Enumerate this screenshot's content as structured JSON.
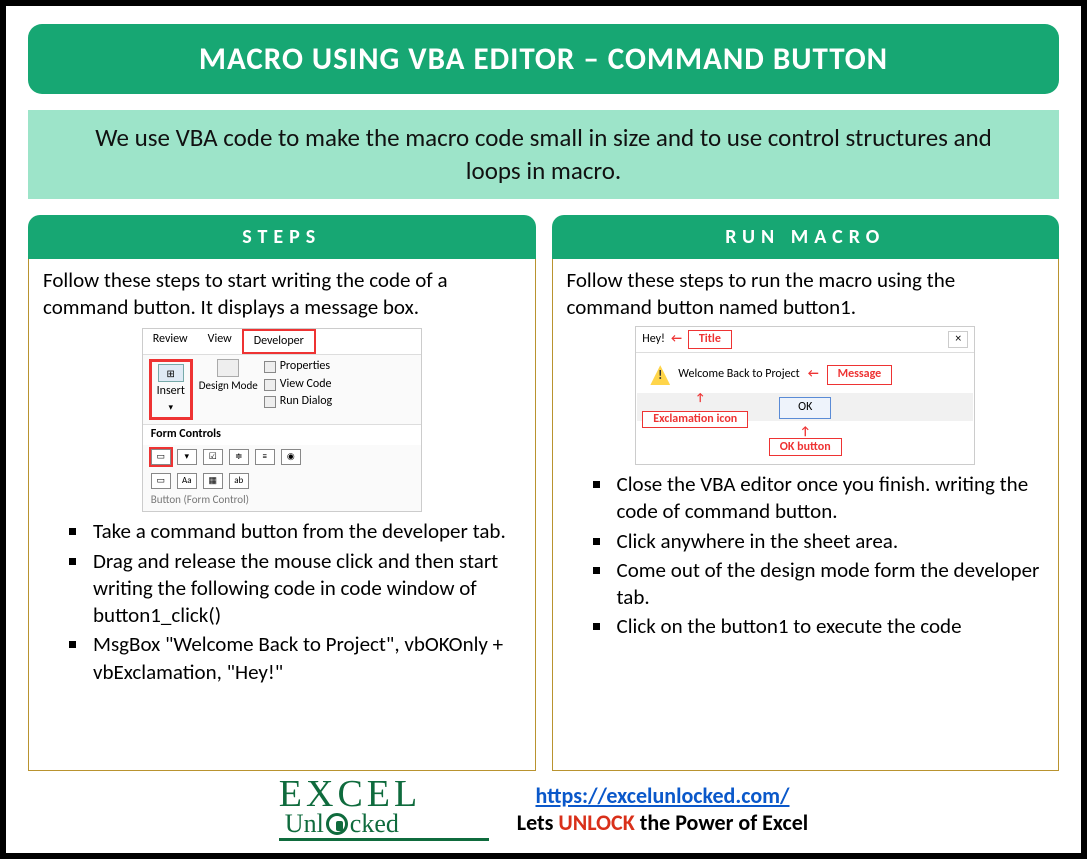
{
  "title": "MACRO USING VBA EDITOR – COMMAND BUTTON",
  "subtitle": "We use VBA code to make the macro code small in size and to use control structures and loops in macro.",
  "left": {
    "header": "STEPS",
    "intro": "Follow these steps to start writing the code of a command button. It displays a message box.",
    "ribbon": {
      "tabs": [
        "Review",
        "View",
        "Developer"
      ],
      "insert": "Insert",
      "design": "Design Mode",
      "props": "Properties",
      "viewcode": "View Code",
      "rundlg": "Run Dialog",
      "form_label": "Form Controls",
      "caption": "Button (Form Control)"
    },
    "bullets": [
      "Take a command button from the developer tab.",
      "Drag and release the mouse click and then start writing the following code in code window of button1_click()",
      "MsgBox \"Welcome Back to Project\", vbOKOnly + vbExclamation, \"Hey!\""
    ]
  },
  "right": {
    "header": "RUN MACRO",
    "intro": "Follow these steps to run the macro using the command button named button1.",
    "msgbox": {
      "titlebar": "Hey!",
      "title_label": "Title",
      "close": "×",
      "message": "Welcome Back to Project",
      "message_label": "Message",
      "icon_label": "Exclamation icon",
      "ok": "OK",
      "ok_label": "OK button"
    },
    "bullets": [
      "Close the VBA editor once you finish. writing the code of command button.",
      "Click anywhere in the sheet area.",
      "Come out of the design mode form the developer tab.",
      "Click on the button1 to execute the code"
    ]
  },
  "footer": {
    "logo_top": "EXCEL",
    "logo_bot_pre": "Unl",
    "logo_bot_post": "cked",
    "url": "https://excelunlocked.com/",
    "tagline_pre": "Lets ",
    "tagline_mid": "UNLOCK",
    "tagline_post": " the Power of Excel"
  }
}
